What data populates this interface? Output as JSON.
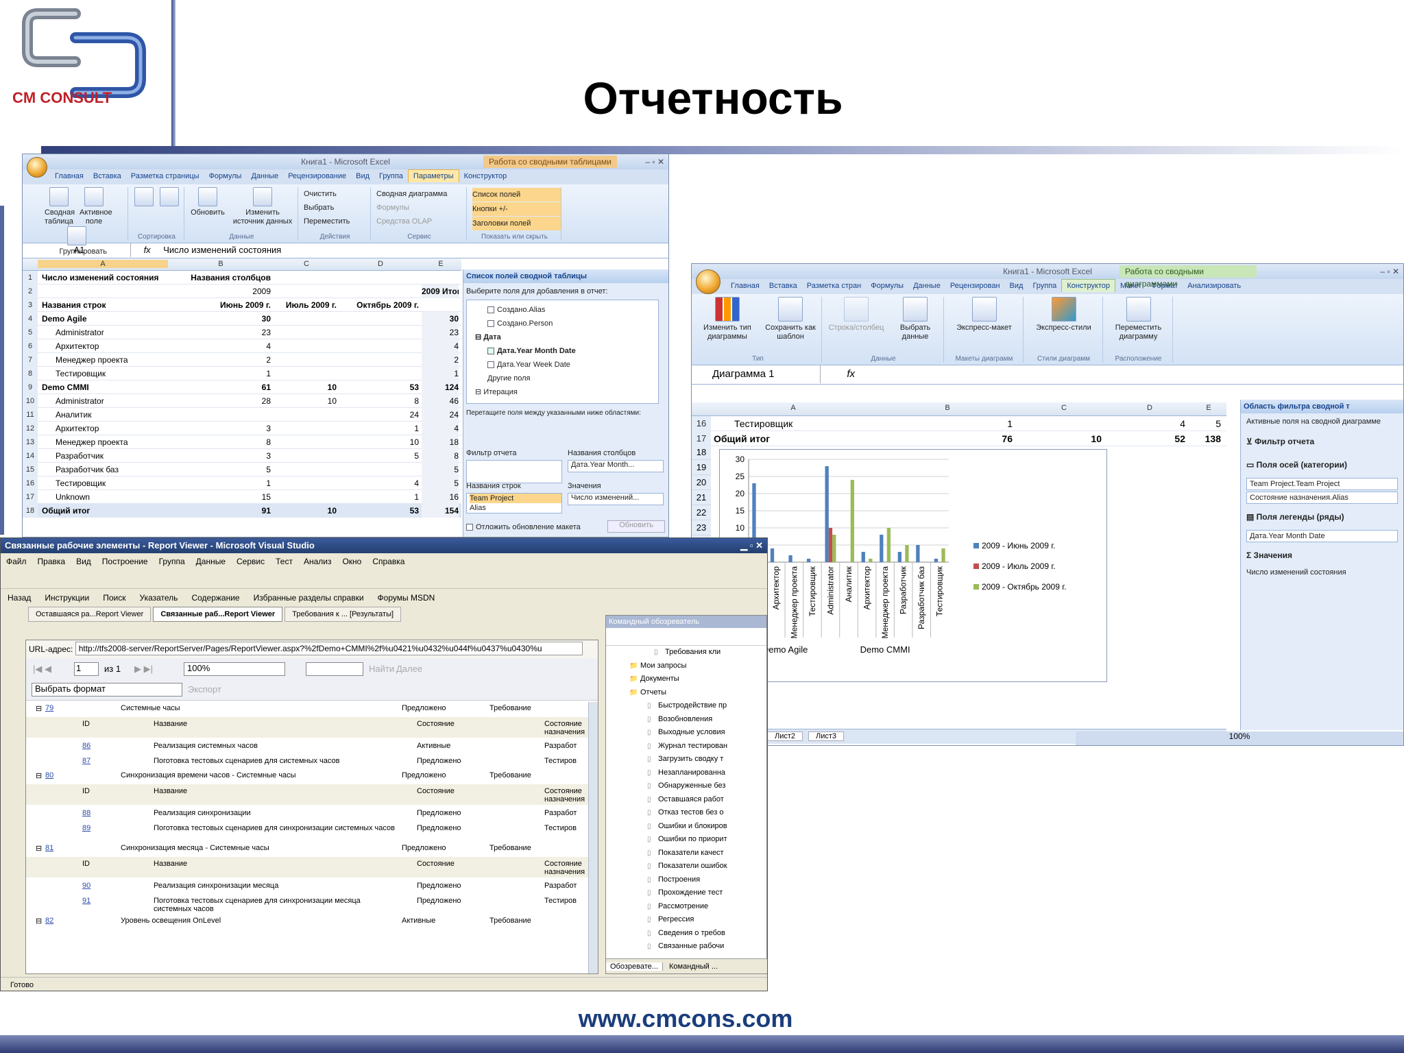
{
  "slide": {
    "title": "Отчетность",
    "logo_text": "CM CONSULT",
    "url": "www.cmcons.com"
  },
  "excel1": {
    "title": "Книга1 - Microsoft Excel",
    "context_tab": "Работа со сводными таблицами",
    "tabs": [
      "Главная",
      "Вставка",
      "Разметка страницы",
      "Формулы",
      "Данные",
      "Рецензирование",
      "Вид",
      "Группа",
      "Параметры",
      "Конструктор"
    ],
    "groups": {
      "g1": [
        "Сводная таблица",
        "Активное поле",
        "Группировать"
      ],
      "g2_label": "Сортировка",
      "g3": [
        "Обновить",
        "Изменить источник данных"
      ],
      "g3_label": "Данные",
      "g4": [
        "Очистить",
        "Выбрать",
        "Переместить"
      ],
      "g4_label": "Действия",
      "g5": [
        "Сводная диаграмма",
        "Формулы",
        "Средства OLAP"
      ],
      "g5_label": "Сервис",
      "g6": [
        "Список полей",
        "Кнопки +/-",
        "Заголовки полей"
      ],
      "g6_label": "Показать или скрыть"
    },
    "namebox": "A1",
    "formula": "Число изменений состояния",
    "cols": [
      "A",
      "B",
      "C",
      "D",
      "E"
    ],
    "rows": [
      {
        "n": "1",
        "a": "Число изменений состояния",
        "b": "Названия столбцов",
        "c": "",
        "d": "",
        "e": ""
      },
      {
        "n": "2",
        "a": "",
        "b": "2009",
        "c": "",
        "d": "",
        "e": "2009 Итог"
      },
      {
        "n": "3",
        "a": "Названия строк",
        "b": "Июнь 2009 г.",
        "c": "Июль 2009 г.",
        "d": "Октябрь 2009 г.",
        "e": ""
      },
      {
        "n": "4",
        "a": "Demo Agile",
        "b": "30",
        "c": "",
        "d": "",
        "e": "30"
      },
      {
        "n": "5",
        "a": "Administrator",
        "b": "23",
        "c": "",
        "d": "",
        "e": "23"
      },
      {
        "n": "6",
        "a": "Архитектор",
        "b": "4",
        "c": "",
        "d": "",
        "e": "4"
      },
      {
        "n": "7",
        "a": "Менеджер проекта",
        "b": "2",
        "c": "",
        "d": "",
        "e": "2"
      },
      {
        "n": "8",
        "a": "Тестировщик",
        "b": "1",
        "c": "",
        "d": "",
        "e": "1"
      },
      {
        "n": "9",
        "a": "Demo CMMI",
        "b": "61",
        "c": "10",
        "d": "53",
        "e": "124"
      },
      {
        "n": "10",
        "a": "Administrator",
        "b": "28",
        "c": "10",
        "d": "8",
        "e": "46"
      },
      {
        "n": "11",
        "a": "Аналитик",
        "b": "",
        "c": "",
        "d": "24",
        "e": "24"
      },
      {
        "n": "12",
        "a": "Архитектор",
        "b": "3",
        "c": "",
        "d": "1",
        "e": "4"
      },
      {
        "n": "13",
        "a": "Менеджер проекта",
        "b": "8",
        "c": "",
        "d": "10",
        "e": "18"
      },
      {
        "n": "14",
        "a": "Разработчик",
        "b": "3",
        "c": "",
        "d": "5",
        "e": "8"
      },
      {
        "n": "15",
        "a": "Разработчик баз",
        "b": "5",
        "c": "",
        "d": "",
        "e": "5"
      },
      {
        "n": "16",
        "a": "Тестировщик",
        "b": "1",
        "c": "",
        "d": "4",
        "e": "5"
      },
      {
        "n": "17",
        "a": "Unknown",
        "b": "15",
        "c": "",
        "d": "1",
        "e": "16"
      },
      {
        "n": "18",
        "a": "Общий итог",
        "b": "91",
        "c": "10",
        "d": "53",
        "e": "154"
      }
    ],
    "fieldlist": {
      "title": "Список полей сводной таблицы",
      "choose": "Выберите поля для добавления в отчет:",
      "fields": [
        "Создано.Alias",
        "Создано.Person",
        "Дата",
        "Дата.Year Month Date",
        "Дата.Year Week Date",
        "Другие поля",
        "Итерация"
      ],
      "drag": "Перетащите поля между указанными ниже областями:",
      "filter": "Фильтр отчета",
      "colnames": "Названия столбцов",
      "colval": "Дата.Year Month...",
      "rownames": "Названия строк",
      "values": "Значения",
      "rowval": "Team Project",
      "rowval2": "Alias",
      "valval": "Число изменений...",
      "defer": "Отложить обновление макета",
      "update": "Обновить"
    }
  },
  "vs": {
    "title": "Связанные рабочие элементы - Report Viewer - Microsoft Visual Studio",
    "menu": [
      "Файл",
      "Правка",
      "Вид",
      "Построение",
      "Группа",
      "Данные",
      "Сервис",
      "Тест",
      "Анализ",
      "Окно",
      "Справка"
    ],
    "toolbar2": [
      "Назад",
      "Инструкции",
      "Поиск",
      "Указатель",
      "Содержание",
      "Избранные разделы справки",
      "Форумы MSDN"
    ],
    "tabs": [
      "Оставшаяся ра...Report Viewer",
      "Связанные раб...Report Viewer",
      "Требования к ... [Результаты]"
    ],
    "url_label": "URL-адрес:",
    "url": "http://tfs2008-server/ReportServer/Pages/ReportViewer.aspx?%2fDemo+CMMI%2f%u0421%u0432%u044f%u0437%u0430%u",
    "pager": {
      "page": "1",
      "of": "из 1",
      "zoom": "100%",
      "find": "Найти",
      "next": "Далее"
    },
    "format": "Выбрать формат",
    "export": "Экспорт",
    "report_rows": [
      {
        "id": "79",
        "name": "Системные часы",
        "state": "Предложено",
        "type": "Требование",
        "top": true
      },
      {
        "hdr": true,
        "id": "ID",
        "name": "Название",
        "state": "Состояние",
        "type": "Состояние назначения"
      },
      {
        "id": "86",
        "name": "Реализация системных часов",
        "state": "Активные",
        "type": "Разработ"
      },
      {
        "id": "87",
        "name": "Поготовка тестовых сценариев для системных часов",
        "state": "Предложено",
        "type": "Тестиров"
      },
      {
        "id": "80",
        "name": "Синхронизация времени часов - Системные часы",
        "state": "Предложено",
        "type": "Требование",
        "top": true
      },
      {
        "hdr": true,
        "id": "ID",
        "name": "Название",
        "state": "Состояние",
        "type": "Состояние назначения"
      },
      {
        "id": "88",
        "name": "Реализация синхронизации",
        "state": "Предложено",
        "type": "Разработ"
      },
      {
        "id": "89",
        "name": "Поготовка тестовых сценариев для синхронизации системных часов",
        "state": "Предложено",
        "type": "Тестиров"
      },
      {
        "id": "81",
        "name": "Синхронизация месяца - Системные часы",
        "state": "Предложено",
        "type": "Требование",
        "top": true
      },
      {
        "hdr": true,
        "id": "ID",
        "name": "Название",
        "state": "Состояние",
        "type": "Состояние назначения"
      },
      {
        "id": "90",
        "name": "Реализация синхронизации месяца",
        "state": "Предложено",
        "type": "Разработ"
      },
      {
        "id": "91",
        "name": "Поготовка тестовых сценариев для синхронизации месяца системных часов",
        "state": "Предложено",
        "type": "Тестиров"
      },
      {
        "id": "82",
        "name": "Уровень освещения OnLevel",
        "state": "Активные",
        "type": "Требование",
        "top": true
      }
    ],
    "status": "Готово",
    "explorer": {
      "title": "Командный обозреватель",
      "items": [
        "Требования кли",
        "Мои запросы",
        "Документы",
        "Отчеты",
        "Быстродействие пр",
        "Возобновления",
        "Выходные условия",
        "Журнал тестирован",
        "Загрузить сводку т",
        "Незапланированна",
        "Обнаруженные без",
        "Оставшаяся работ",
        "Отказ тестов без о",
        "Ошибки и блокиров",
        "Ошибки по приорит",
        "Показатели качест",
        "Показатели ошибок",
        "Построения",
        "Прохождение тест",
        "Рассмотрение",
        "Регрессия",
        "Сведения о требов",
        "Связанные рабочи"
      ],
      "tabs": [
        "Обозревате...",
        "Командный ..."
      ]
    }
  },
  "excel2": {
    "title": "Книга1 - Microsoft Excel",
    "context_tab": "Работа со сводными диаграммами",
    "tabs": [
      "Главная",
      "Вставка",
      "Разметка стран",
      "Формулы",
      "Данные",
      "Рецензирован",
      "Вид",
      "Группа",
      "Конструктор",
      "Макет",
      "Формат",
      "Анализировать"
    ],
    "buttons": [
      "Изменить тип диаграммы",
      "Сохранить как шаблон",
      "Строка/столбец",
      "Выбрать данные",
      "Экспресс-макет",
      "Экспресс-стили",
      "Переместить диаграмму"
    ],
    "group_labels": [
      "Тип",
      "Данные",
      "Макеты диаграмм",
      "Стили диаграмм",
      "Расположение"
    ],
    "namebox": "Диаграмма 1",
    "cols": [
      "A",
      "B",
      "C",
      "D",
      "E"
    ],
    "rows": [
      {
        "n": "16",
        "a": "Тестировщик",
        "b": "1",
        "c": "",
        "d": "4",
        "e": "5"
      },
      {
        "n": "17",
        "a": "Общий итог",
        "b": "76",
        "c": "10",
        "d": "52",
        "e": "138"
      }
    ],
    "rownums": [
      "18",
      "19",
      "20",
      "21",
      "22",
      "23",
      "24",
      "25",
      "26",
      "27",
      "28",
      "29",
      "30",
      "31",
      "32",
      "33"
    ],
    "sheets": [
      "Лист2",
      "Лист3"
    ],
    "zoom": "100%",
    "pane": {
      "title": "Область фильтра сводной т",
      "active": "Активные поля на сводной диаграмме",
      "filter": "Фильтр отчета",
      "axis": "Поля осей (категории)",
      "axis1": "Team Project.Team Project",
      "axis2": "Состояние назначения.Alias",
      "legend": "Поля легенды (ряды)",
      "legend1": "Дата.Year Month Date",
      "values": "Значения",
      "values1": "Число изменений состояния"
    }
  },
  "chart_data": {
    "type": "bar",
    "categories": [
      "Administrator",
      "Архитектор",
      "Менеджер проекта",
      "Тестировщик",
      "Administrator",
      "Аналитик",
      "Архитектор",
      "Менеджер проекта",
      "Разработчик",
      "Разработчик баз",
      "Тестировщик"
    ],
    "groups": [
      "Demo Agile",
      "Demo CMMI"
    ],
    "group_sizes": [
      4,
      7
    ],
    "series": [
      {
        "name": "2009 - Июнь 2009 г.",
        "color": "#4f81bd",
        "values": [
          23,
          4,
          2,
          1,
          28,
          0,
          3,
          8,
          3,
          5,
          1
        ]
      },
      {
        "name": "2009 - Июль 2009 г.",
        "color": "#c0504d",
        "values": [
          0,
          0,
          0,
          0,
          10,
          0,
          0,
          0,
          0,
          0,
          0
        ]
      },
      {
        "name": "2009 - Октябрь 2009 г.",
        "color": "#9bbb59",
        "values": [
          0,
          0,
          0,
          0,
          8,
          24,
          1,
          10,
          5,
          0,
          4
        ]
      }
    ],
    "ylim": [
      0,
      30
    ],
    "yticks": [
      "0",
      "5",
      "10",
      "15",
      "20",
      "25",
      "30"
    ],
    "legend": "right"
  }
}
